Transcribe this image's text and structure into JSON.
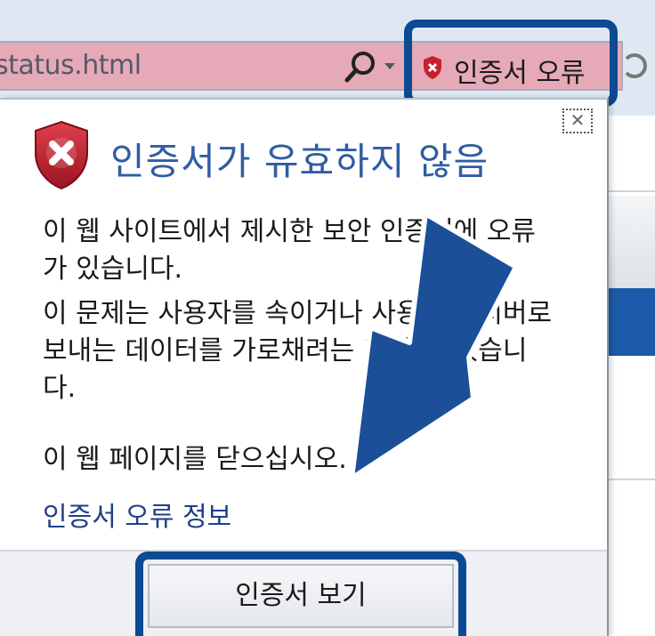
{
  "address_bar": {
    "url_fragment": "status.html",
    "cert_error_label": "인증서 오류"
  },
  "popup": {
    "title": "인증서가 유효하지 않음",
    "close_glyph": "✕",
    "message1": "이 웹 사이트에서 제시한 보안 인증서에 오류가 있습니다.",
    "message2": "이 문제는 사용자를 속이거나 사용자가 서버로 보내는 데이터를 가로채려는 것일 수 있습니다.",
    "message3": "이 웹 페이지를 닫으십시오.",
    "cert_info_link": "인증서 오류 정보",
    "view_cert_button": "인증서 보기"
  },
  "colors": {
    "accent": "#0c4a92",
    "title": "#2e5da3",
    "address_bar_error": "#e6a9b8",
    "error_red": "#c8202e",
    "arrow": "#1b4f98"
  },
  "icons": {
    "address_search": "search-icon",
    "dropdown": "chevron-down-icon",
    "cert_error": "error-shield-icon",
    "popup_header": "error-shield-icon",
    "close": "close-icon",
    "annotation": "arrow-icon"
  }
}
